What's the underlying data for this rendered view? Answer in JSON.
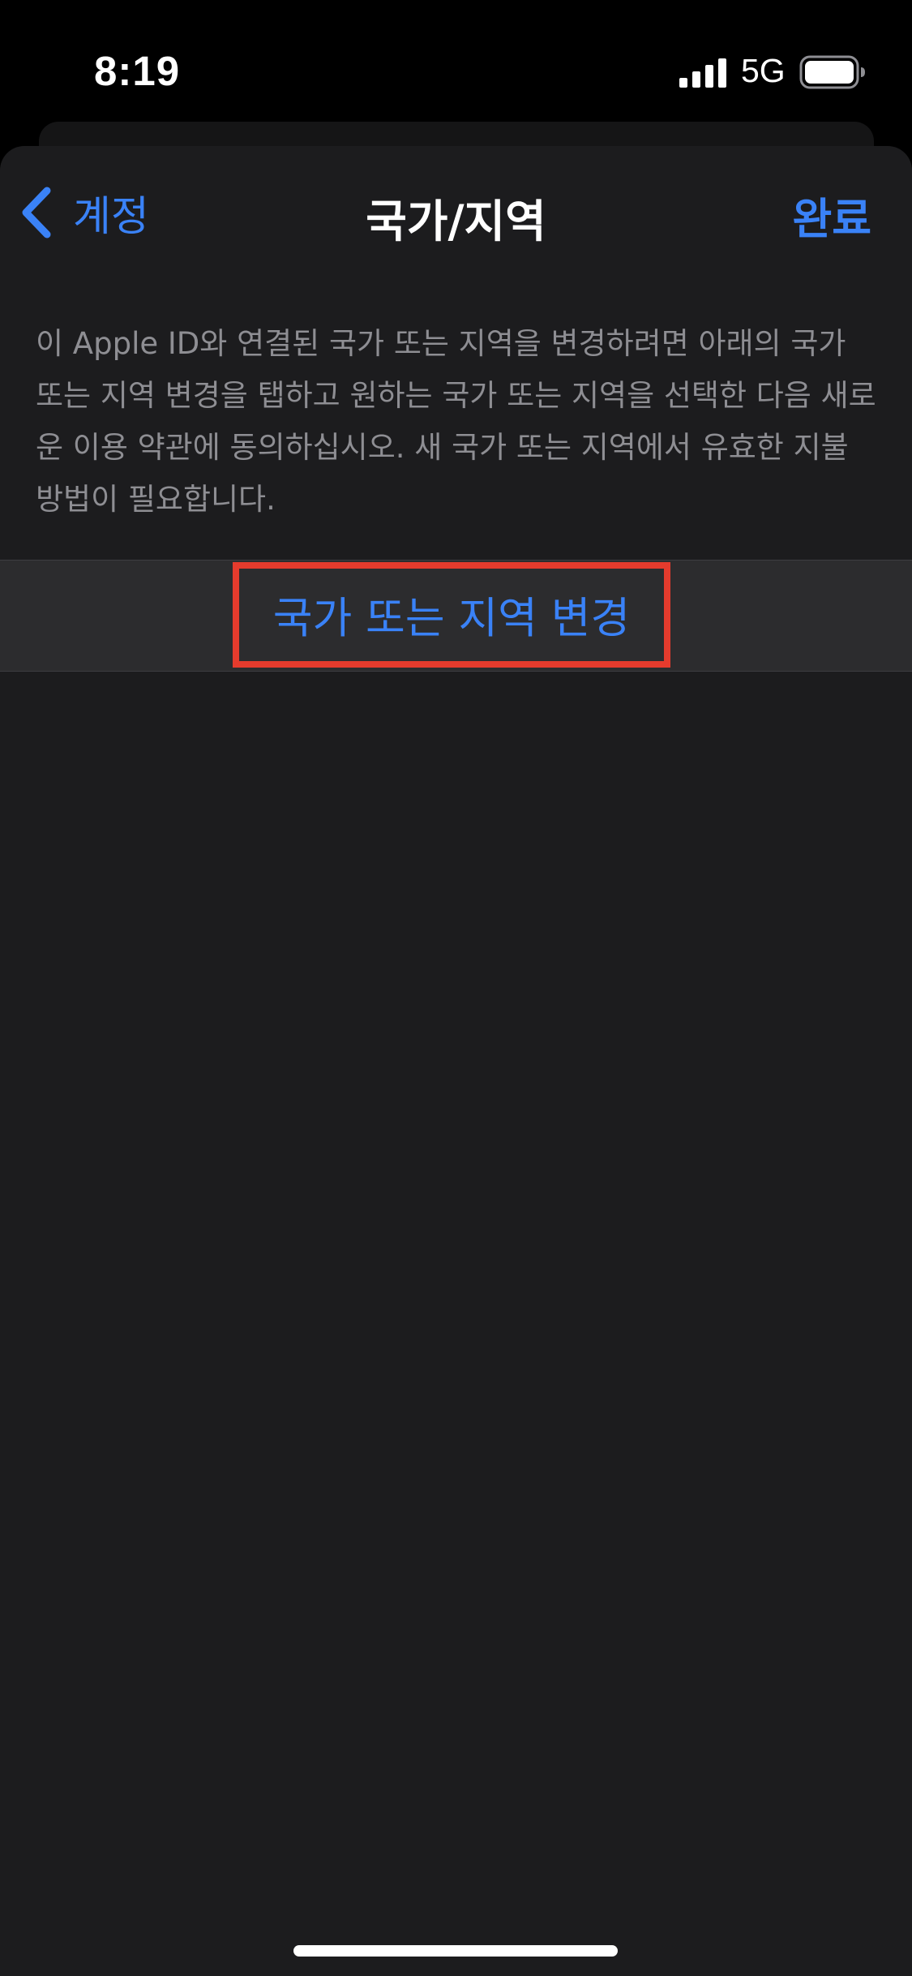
{
  "status_bar": {
    "time": "8:19",
    "network": "5G",
    "signal_icon": "cellular-signal-icon",
    "battery_icon": "battery-icon"
  },
  "nav": {
    "back_label": "계정",
    "back_icon": "chevron-left-icon",
    "title": "국가/지역",
    "done_label": "완료"
  },
  "description": "이 Apple ID와 연결된 국가 또는 지역을 변경하려면 아래의 국가 또는 지역 변경을 탭하고 원하는 국가 또는 지역을 선택한 다음 새로운 이용 약관에 동의하십시오. 새 국가 또는 지역에서 유효한 지불 방법이 필요합니다.",
  "action": {
    "label": "국가 또는 지역 변경"
  },
  "colors": {
    "accent": "#3a82f7",
    "highlight": "#e53b2d",
    "background": "#1c1c1e",
    "row_background": "#2c2c2e",
    "secondary_text": "#8e8e93"
  }
}
